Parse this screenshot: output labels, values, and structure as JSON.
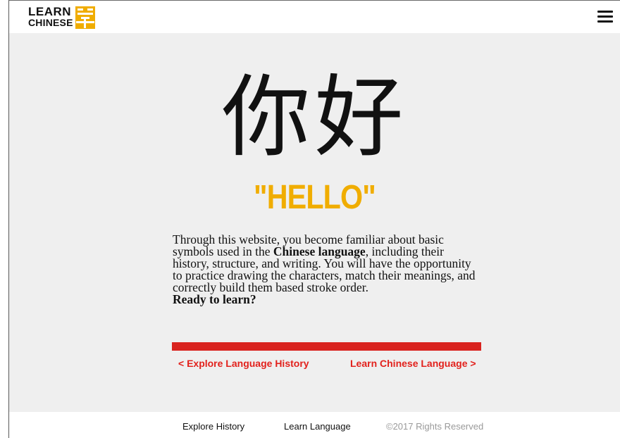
{
  "header": {
    "logo_line1": "LEARN",
    "logo_line2": "CHINESE",
    "logo_icon": "zi-character-logo-icon",
    "menu_icon": "hamburger-menu-icon"
  },
  "hero": {
    "characters": "你好",
    "translation": "\"HELLO\""
  },
  "intro": {
    "part1": "Through this website, you become familiar about basic symbols used in the ",
    "bold": "Chinese language",
    "part2": ", including their history, structure, and writing. You will have the opportunity to practice drawing the characters, match their meanings, and correctly build them based stroke order.",
    "ready": "Ready to learn?"
  },
  "nav": {
    "prev_label": "< Explore Language History",
    "next_label": "Learn Chinese Language >"
  },
  "footer": {
    "history": "Explore History",
    "learn": "Learn Language",
    "copyright": "©2017 Rights Reserved"
  },
  "colors": {
    "accent_yellow": "#f0ad00",
    "accent_red": "#d9231f",
    "background": "#efefef"
  }
}
